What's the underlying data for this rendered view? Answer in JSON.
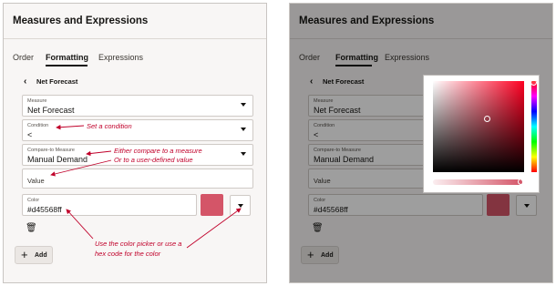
{
  "app_title": "Measures and Expressions",
  "tabs": [
    {
      "label": "Order"
    },
    {
      "label": "Formatting"
    },
    {
      "label": "Expressions"
    }
  ],
  "breadcrumb": "Net Forecast",
  "measure": {
    "label": "Measure",
    "value": "Net Forecast"
  },
  "condition": {
    "label": "Condition",
    "value": "<"
  },
  "compare": {
    "label": "Compare-to Measure",
    "value": "Manual Demand"
  },
  "value_field": {
    "placeholder": "Value"
  },
  "color": {
    "label": "Color",
    "value": "#d45568ff",
    "swatch": "#d45568",
    "swatch_dimmed": "#9a3a47"
  },
  "add_label": "Add",
  "annotations": {
    "condition": "Set a condition",
    "compare_1": "Either compare to a measure",
    "compare_2": "Or to a user-defined value",
    "picker_1": "Use the color picker or use a",
    "picker_2": "hex code for the color"
  },
  "picker": {
    "hue_color": "#ff0022"
  },
  "icons": {
    "back": "chevron-left-icon",
    "trash": "trash-icon",
    "add": "plus-icon",
    "dropdown": "caret-down-icon"
  },
  "colors": {
    "accent_annotation": "#c0002a",
    "panel_bg": "#f8f6f5"
  }
}
